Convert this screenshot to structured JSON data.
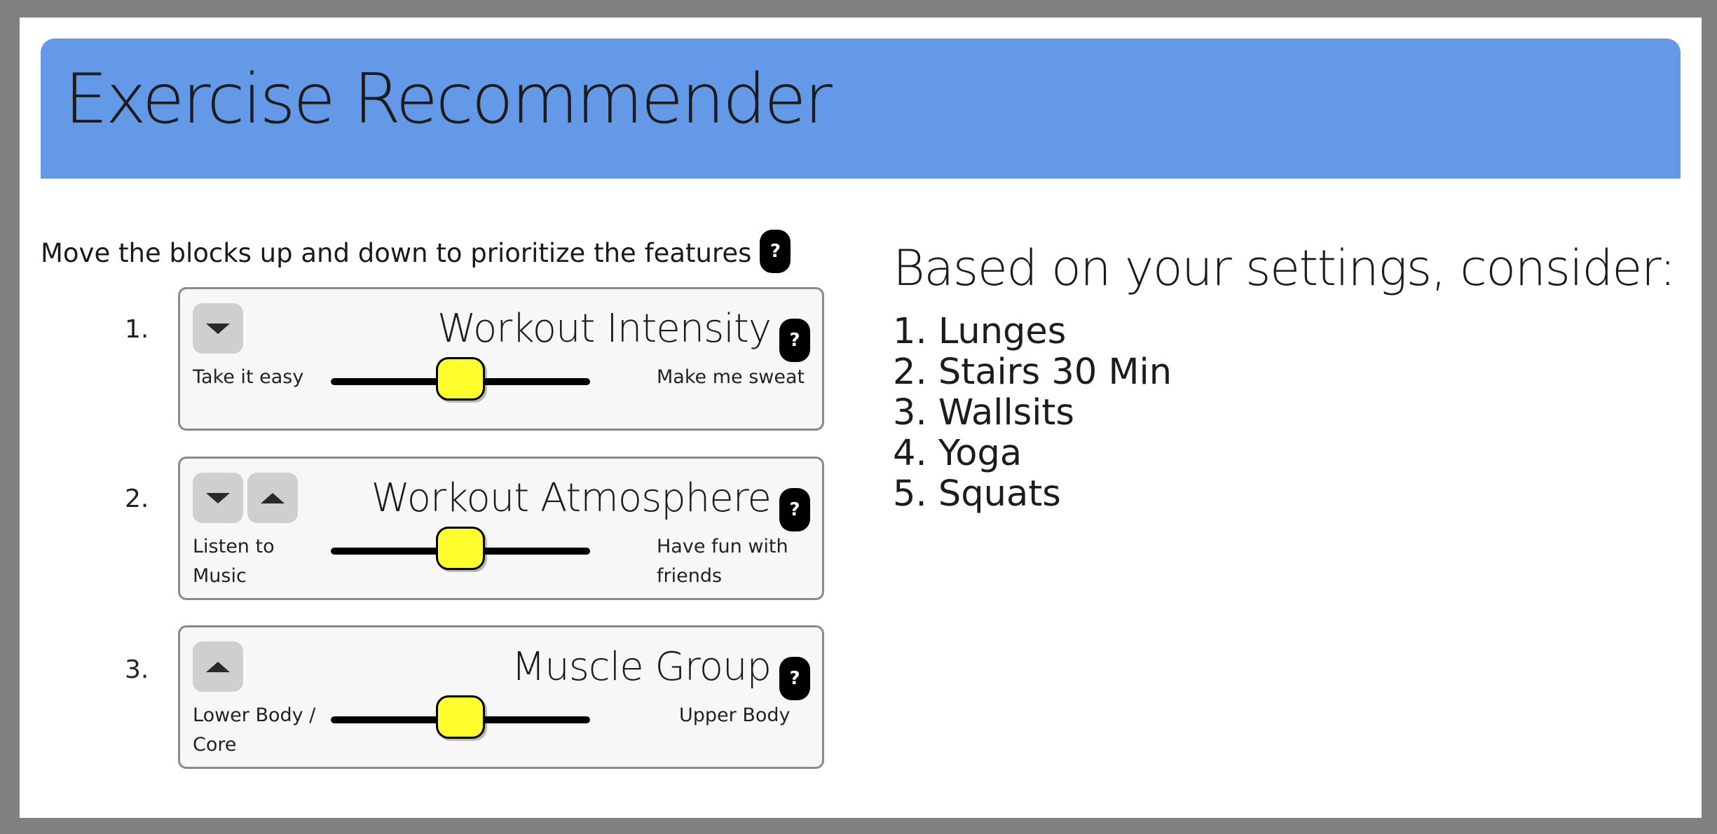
{
  "app": {
    "title": "Exercise Recommender"
  },
  "instructions": {
    "text": "Move the blocks up and down to prioritize the features",
    "help": "?"
  },
  "features": [
    {
      "rank": "1.",
      "title": "Workout Intensity",
      "help": "?",
      "left_label": "Take it easy",
      "right_label": "Make me sweat",
      "slider_value": 0.5,
      "buttons": [
        "chevron-down-icon"
      ]
    },
    {
      "rank": "2.",
      "title": "Workout Atmosphere",
      "help": "?",
      "left_label": "Listen to Music",
      "right_label": "Have fun with friends",
      "slider_value": 0.5,
      "buttons": [
        "chevron-down-icon",
        "chevron-up-icon"
      ]
    },
    {
      "rank": "3.",
      "title": "Muscle Group",
      "help": "?",
      "left_label": "Lower Body / Core",
      "right_label": "Upper Body",
      "slider_value": 0.5,
      "buttons": [
        "chevron-up-icon"
      ]
    }
  ],
  "recommendations": {
    "title": "Based on your settings, consider:",
    "items": [
      "1. Lunges",
      "2. Stairs 30 Min",
      "3. Wallsits",
      "4. Yoga",
      "5. Squats"
    ]
  },
  "colors": {
    "header": "#6399e6",
    "slider_thumb": "#ffff2e",
    "card_bg": "#f7f7f7",
    "frame": "#808080"
  }
}
